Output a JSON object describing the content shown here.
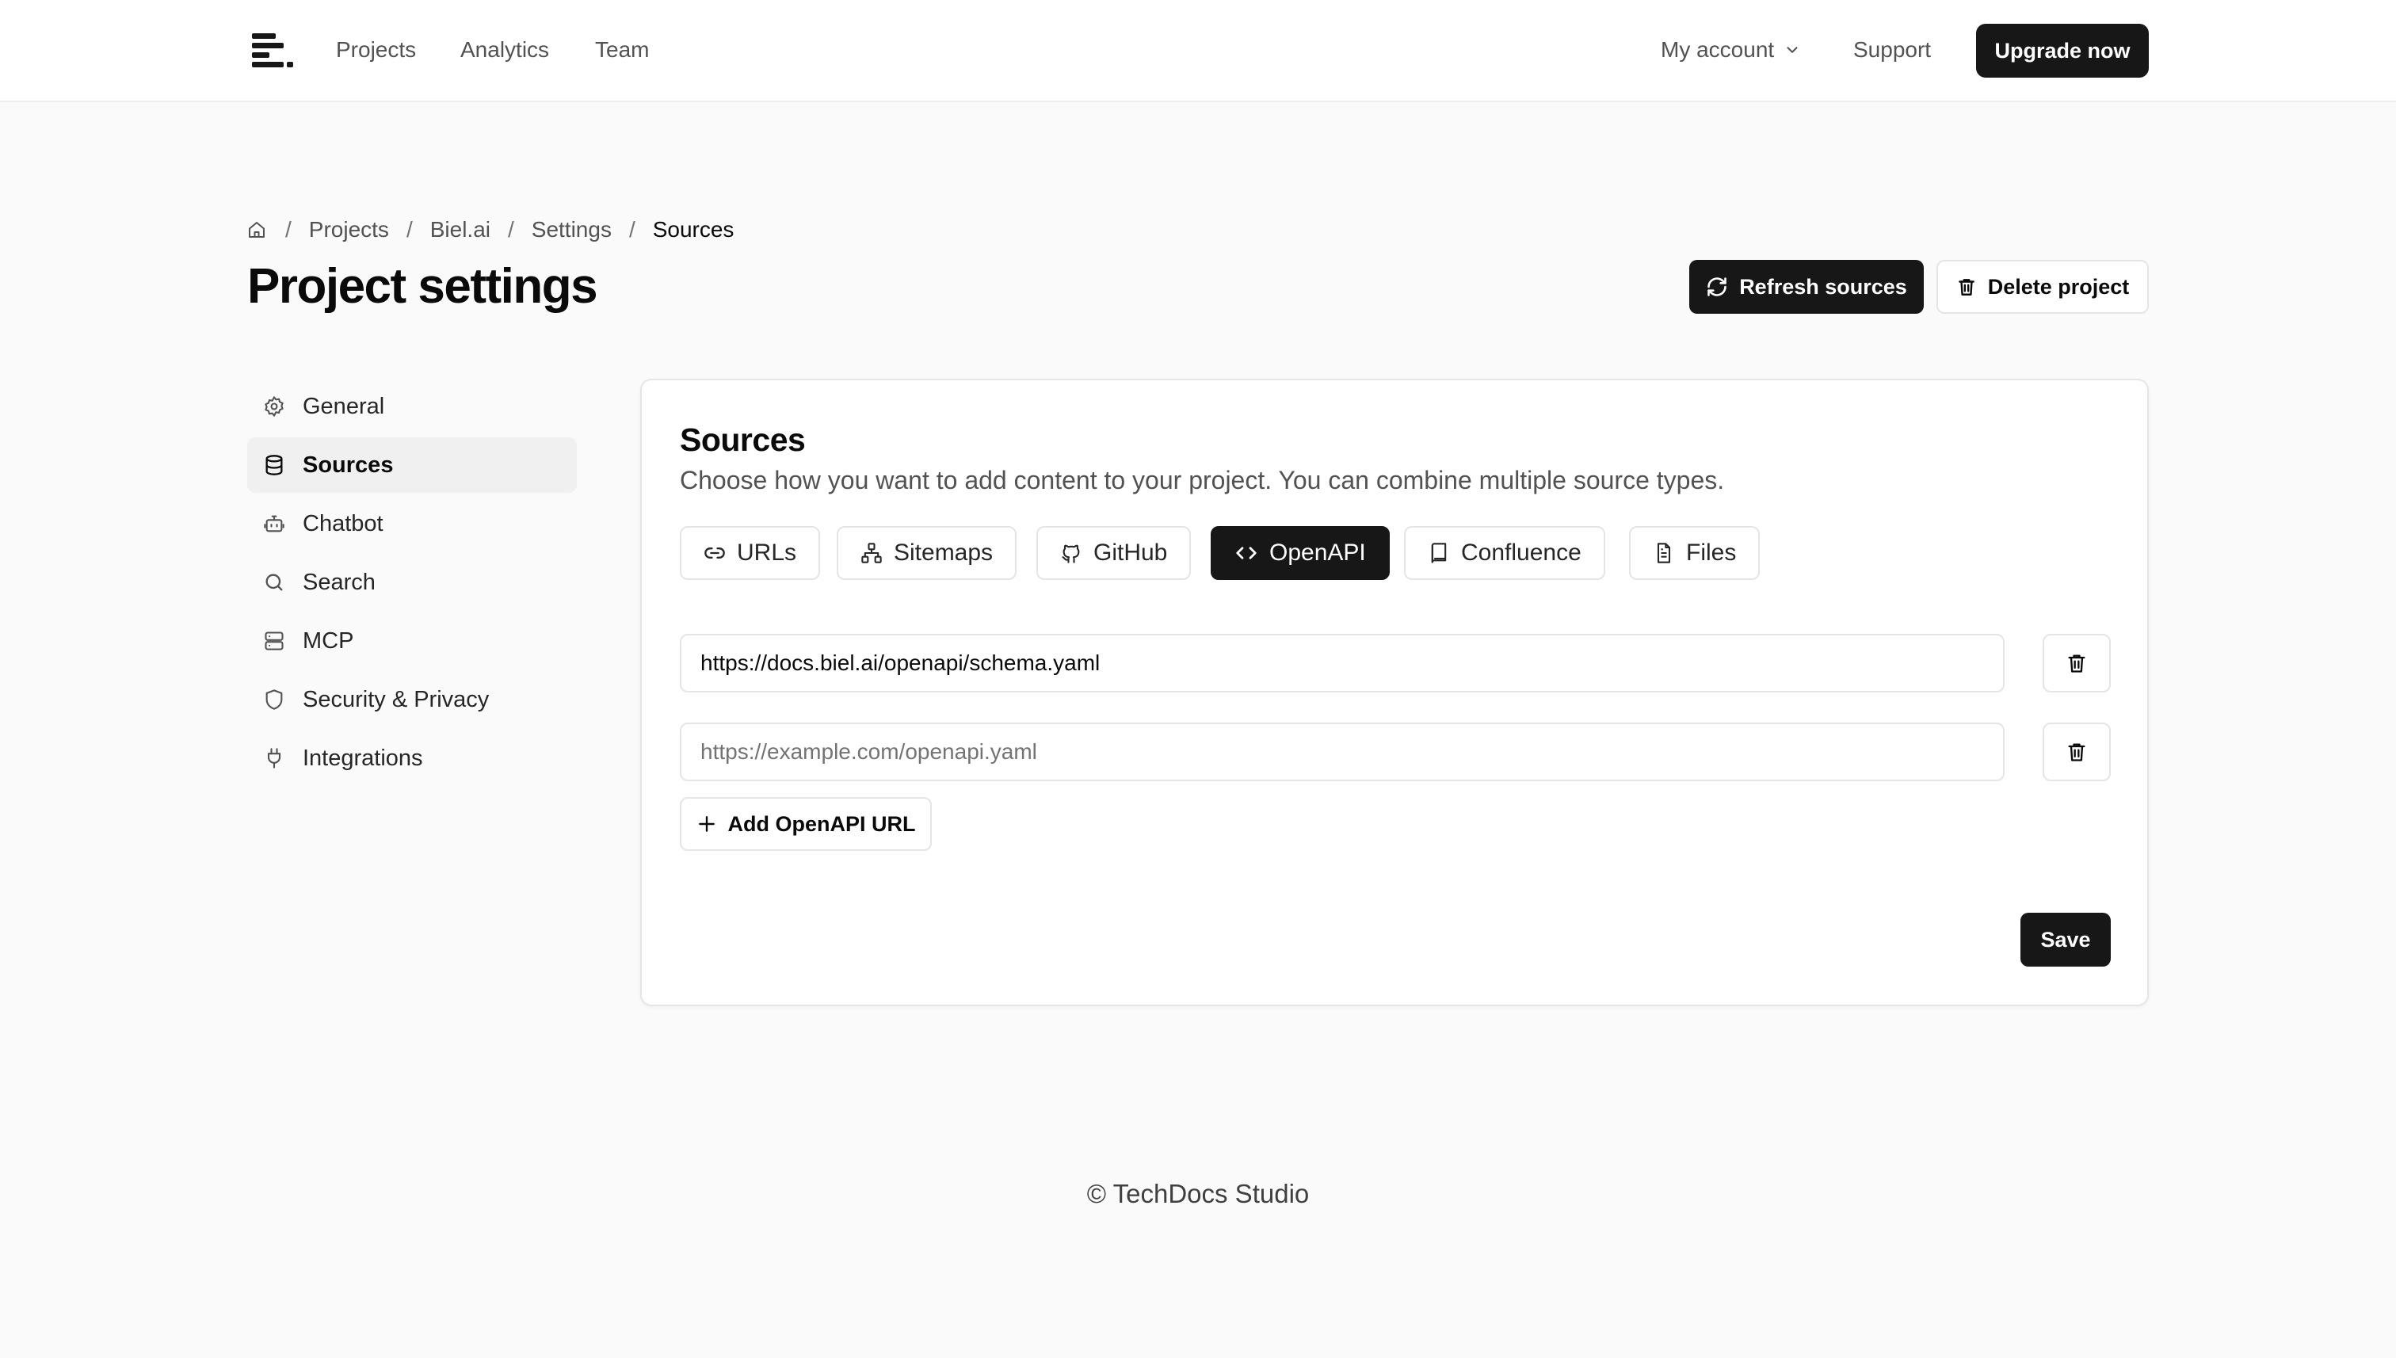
{
  "header": {
    "nav": [
      {
        "label": "Projects"
      },
      {
        "label": "Analytics"
      },
      {
        "label": "Team"
      }
    ],
    "account_label": "My account",
    "support_label": "Support",
    "upgrade_label": "Upgrade now"
  },
  "breadcrumb": {
    "items": [
      {
        "label": "Projects"
      },
      {
        "label": "Biel.ai"
      },
      {
        "label": "Settings"
      },
      {
        "label": "Sources"
      }
    ],
    "separator": "/"
  },
  "page": {
    "title": "Project settings",
    "refresh_label": "Refresh sources",
    "delete_label": "Delete project"
  },
  "sidebar": {
    "items": [
      {
        "label": "General",
        "icon": "gear-icon"
      },
      {
        "label": "Sources",
        "icon": "database-icon",
        "active": true
      },
      {
        "label": "Chatbot",
        "icon": "bot-icon"
      },
      {
        "label": "Search",
        "icon": "search-icon"
      },
      {
        "label": "MCP",
        "icon": "server-icon"
      },
      {
        "label": "Security & Privacy",
        "icon": "shield-icon"
      },
      {
        "label": "Integrations",
        "icon": "plug-icon"
      }
    ]
  },
  "sources": {
    "title": "Sources",
    "subtitle": "Choose how you want to add content to your project. You can combine multiple source types.",
    "tabs": [
      {
        "label": "URLs",
        "icon": "link-icon"
      },
      {
        "label": "Sitemaps",
        "icon": "sitemap-icon"
      },
      {
        "label": "GitHub",
        "icon": "github-icon"
      },
      {
        "label": "OpenAPI",
        "icon": "code-icon",
        "active": true
      },
      {
        "label": "Confluence",
        "icon": "book-icon"
      },
      {
        "label": "Files",
        "icon": "file-icon"
      }
    ],
    "urls": [
      {
        "value": "https://docs.biel.ai/openapi/schema.yaml",
        "placeholder": ""
      },
      {
        "value": "",
        "placeholder": "https://example.com/openapi.yaml"
      }
    ],
    "add_label": "Add OpenAPI URL",
    "save_label": "Save"
  },
  "footer": {
    "text": "© TechDocs Studio"
  },
  "colors": {
    "primary": "#171717",
    "background": "#fafafa",
    "border": "#e5e5e5",
    "muted_text": "#525252"
  }
}
